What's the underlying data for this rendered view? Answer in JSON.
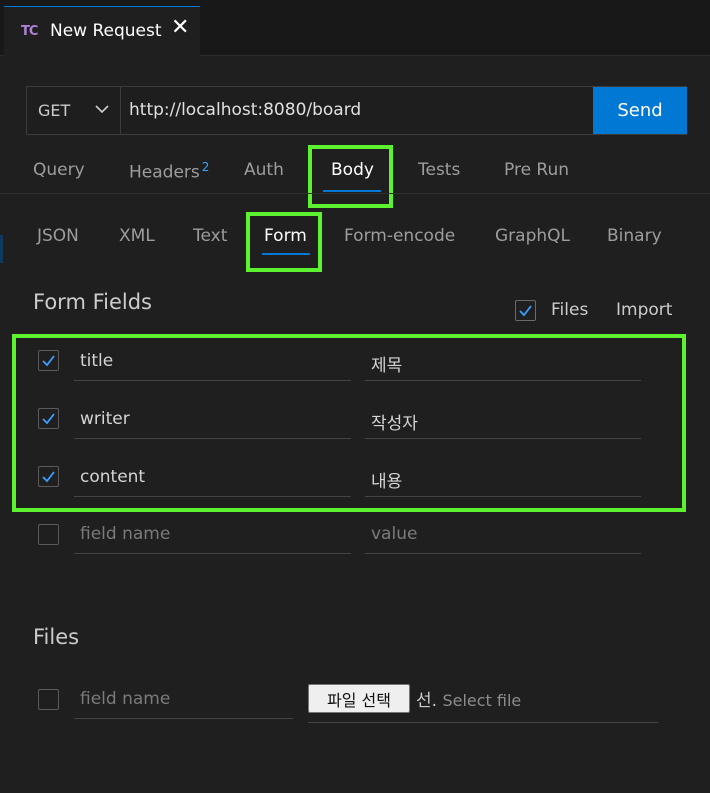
{
  "tab": {
    "icon": "TC",
    "title": "New Request",
    "close": "✕"
  },
  "request": {
    "method": "GET",
    "url": "http://localhost:8080/board",
    "send_label": "Send"
  },
  "nav_tabs": [
    {
      "label": "Query"
    },
    {
      "label": "Headers",
      "badge": "2"
    },
    {
      "label": "Auth"
    },
    {
      "label": "Body",
      "active": true
    },
    {
      "label": "Tests"
    },
    {
      "label": "Pre Run"
    }
  ],
  "body_tabs": [
    {
      "label": "JSON"
    },
    {
      "label": "XML"
    },
    {
      "label": "Text"
    },
    {
      "label": "Form",
      "active": true
    },
    {
      "label": "Form-encode"
    },
    {
      "label": "GraphQL"
    },
    {
      "label": "Binary"
    }
  ],
  "form": {
    "title": "Form Fields",
    "files_toggle_label": "Files",
    "files_toggle_checked": true,
    "import_label": "Import",
    "rows": [
      {
        "checked": true,
        "name": "title",
        "value": "제목"
      },
      {
        "checked": true,
        "name": "writer",
        "value": "작성자"
      },
      {
        "checked": true,
        "name": "content",
        "value": "내용"
      }
    ],
    "new_row": {
      "checked": false,
      "name_placeholder": "field name",
      "value_placeholder": "value"
    }
  },
  "files": {
    "title": "Files",
    "row": {
      "checked": false,
      "name_placeholder": "field name",
      "choose_button": "파일 선택",
      "choose_suffix": "선.",
      "select_placeholder": "Select file"
    }
  },
  "colors": {
    "accent": "#0078d4",
    "highlight": "#5cf230",
    "background": "#1f1f1f"
  }
}
